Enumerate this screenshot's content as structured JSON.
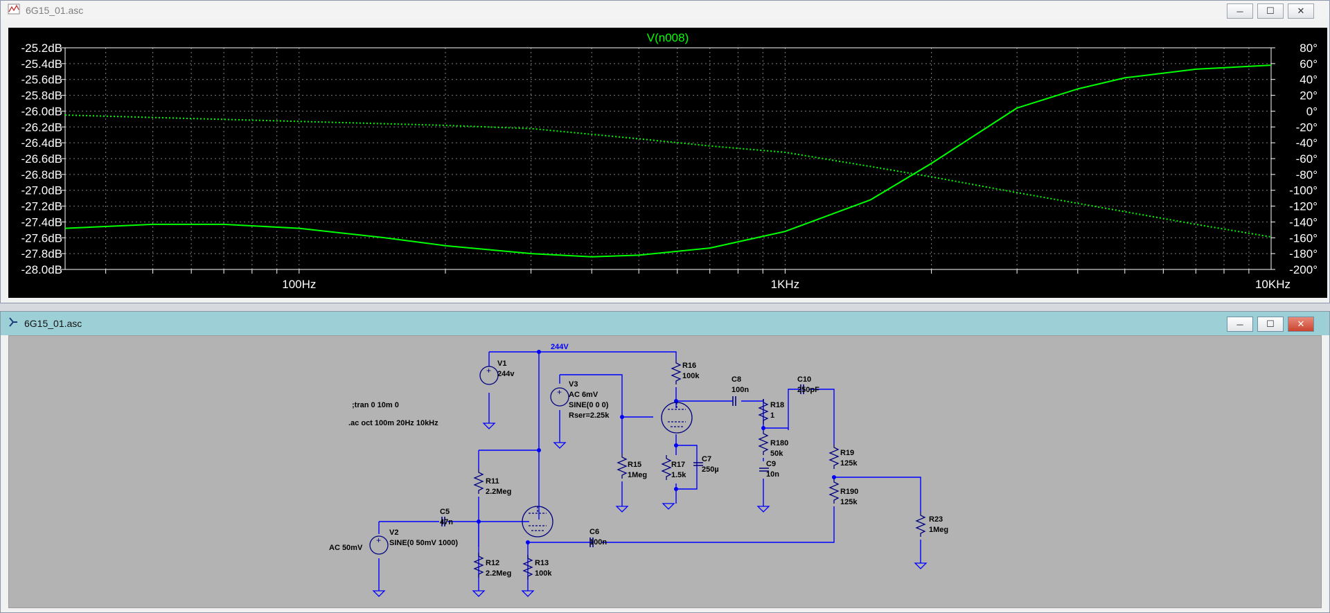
{
  "plot_window": {
    "title": "6G15_01.asc",
    "controls": {
      "minimize": "─",
      "maximize": "☐",
      "close": "✕"
    }
  },
  "schematic_window": {
    "title": "6G15_01.asc",
    "controls": {
      "minimize": "─",
      "maximize": "☐",
      "close": "✕"
    }
  },
  "colors": {
    "trace": "#00ff00",
    "grid": "#808080",
    "wire": "#0000ff",
    "component": "#000080",
    "plot_bg": "#000000",
    "sch_bg": "#b3b3b3"
  },
  "chart_data": {
    "type": "line",
    "title": "V(n008)",
    "x_scale": "log",
    "xlim": [
      33,
      10000
    ],
    "x_ticks": [
      {
        "value": 100,
        "label": "100Hz"
      },
      {
        "value": 1000,
        "label": "1KHz"
      },
      {
        "value": 10000,
        "label": "10KHz"
      }
    ],
    "ylim": [
      -28.0,
      -25.2
    ],
    "y_ticks": [
      "-25.2dB",
      "-25.4dB",
      "-25.6dB",
      "-25.8dB",
      "-26.0dB",
      "-26.2dB",
      "-26.4dB",
      "-26.6dB",
      "-26.8dB",
      "-27.0dB",
      "-27.2dB",
      "-27.4dB",
      "-27.6dB",
      "-27.8dB",
      "-28.0dB"
    ],
    "y_tick_values": [
      -25.2,
      -25.4,
      -25.6,
      -25.8,
      -26.0,
      -26.2,
      -26.4,
      -26.6,
      -26.8,
      -27.0,
      -27.2,
      -27.4,
      -27.6,
      -27.8,
      -28.0
    ],
    "y2lim": [
      -200,
      80
    ],
    "y2_ticks": [
      "80°",
      "60°",
      "40°",
      "20°",
      "0°",
      "-20°",
      "-40°",
      "-60°",
      "-80°",
      "-100°",
      "-120°",
      "-140°",
      "-160°",
      "-180°",
      "-200°"
    ],
    "y2_tick_values": [
      80,
      60,
      40,
      20,
      0,
      -20,
      -40,
      -60,
      -80,
      -100,
      -120,
      -140,
      -160,
      -180,
      -200
    ],
    "grid": true,
    "series": [
      {
        "axis": "left",
        "style": "solid",
        "x": [
          33,
          50,
          70,
          100,
          150,
          200,
          300,
          400,
          500,
          700,
          1000,
          1500,
          2000,
          3000,
          4000,
          5000,
          7000,
          10000
        ],
        "y": [
          -27.48,
          -27.43,
          -27.43,
          -27.48,
          -27.6,
          -27.7,
          -27.8,
          -27.84,
          -27.82,
          -27.73,
          -27.52,
          -27.12,
          -26.66,
          -25.96,
          -25.72,
          -25.58,
          -25.47,
          -25.42
        ]
      },
      {
        "axis": "right",
        "style": "dotted",
        "x": [
          33,
          50,
          100,
          200,
          300,
          500,
          700,
          1000,
          1500,
          2000,
          3000,
          5000,
          7000,
          10000
        ],
        "y": [
          -5,
          -8,
          -13,
          -18,
          -22,
          -35,
          -44,
          -52,
          -70,
          -83,
          -103,
          -127,
          -143,
          -159
        ]
      }
    ]
  },
  "schematic": {
    "directives": [
      ";tran 0 10m 0",
      ".ac oct 100m 20Hz 10kHz"
    ],
    "net_label": "244V",
    "components": [
      {
        "id": "V1",
        "lines": [
          "V1",
          "244v"
        ]
      },
      {
        "id": "V2",
        "lines": [
          "V2",
          "SINE(0 50mV 1000)"
        ],
        "side": "AC 50mV"
      },
      {
        "id": "V3",
        "lines": [
          "V3",
          "AC 6mV",
          "SINE(0 0 0)",
          "Rser=2.25k"
        ]
      },
      {
        "id": "R11",
        "lines": [
          "R11",
          "2.2Meg"
        ]
      },
      {
        "id": "R12",
        "lines": [
          "R12",
          "2.2Meg"
        ]
      },
      {
        "id": "R13",
        "lines": [
          "R13",
          "100k"
        ]
      },
      {
        "id": "R15",
        "lines": [
          "R15",
          "1Meg"
        ]
      },
      {
        "id": "R16",
        "lines": [
          "R16",
          "100k"
        ]
      },
      {
        "id": "R17",
        "lines": [
          "R17",
          "1.5k"
        ]
      },
      {
        "id": "R18",
        "lines": [
          "R18",
          "1"
        ]
      },
      {
        "id": "R180",
        "lines": [
          "R180",
          "50k"
        ]
      },
      {
        "id": "R19",
        "lines": [
          "R19",
          "125k"
        ]
      },
      {
        "id": "R190",
        "lines": [
          "R190",
          "125k"
        ]
      },
      {
        "id": "R23",
        "lines": [
          "R23",
          "1Meg"
        ]
      },
      {
        "id": "C5",
        "lines": [
          "C5",
          "47n"
        ]
      },
      {
        "id": "C6",
        "lines": [
          "C6",
          "100n"
        ]
      },
      {
        "id": "C7",
        "lines": [
          "C7",
          "250µ"
        ]
      },
      {
        "id": "C8",
        "lines": [
          "C8",
          "100n"
        ]
      },
      {
        "id": "C9",
        "lines": [
          "C9",
          "10n"
        ]
      },
      {
        "id": "C10",
        "lines": [
          "C10",
          "250pF"
        ]
      }
    ]
  }
}
